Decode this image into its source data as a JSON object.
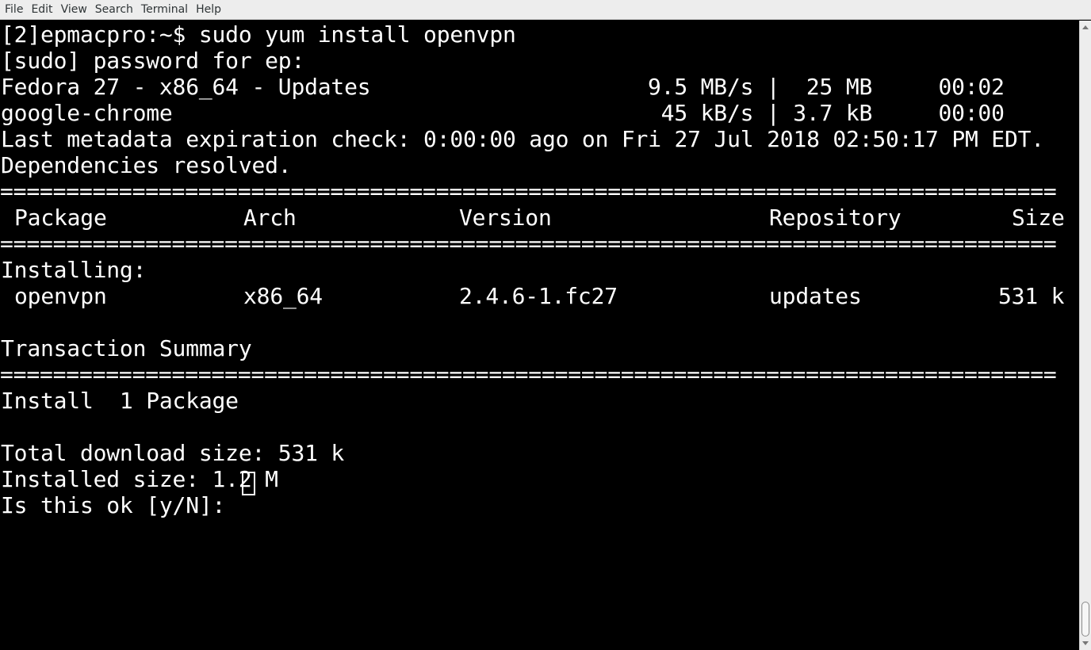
{
  "menu": {
    "file": "File",
    "edit": "Edit",
    "view": "View",
    "search": "Search",
    "terminal": "Terminal",
    "help": "Help"
  },
  "terminal": {
    "lines": {
      "command": "[2]epmacpro:~$ sudo yum install openvpn",
      "sudo_prompt": "[sudo] password for ep:",
      "repo1_name": "Fedora 27 - x86_64 - Updates",
      "repo1_stats": "9.5 MB/s |  25 MB     00:02",
      "repo2_name": "google-chrome",
      "repo2_stats": " 45 kB/s | 3.7 kB     00:00",
      "metadata": "Last metadata expiration check: 0:00:00 ago on Fri 27 Jul 2018 02:50:17 PM EDT.",
      "resolved": "Dependencies resolved.",
      "rule": "================================================================================",
      "installing": "Installing:",
      "transaction_summary": "Transaction Summary",
      "install_count": "Install  1 Package",
      "total_download": "Total download size: 531 k",
      "installed_size": "Installed size: 1.2 M",
      "confirm_prompt": "Is this ok [y/N]: "
    },
    "table": {
      "headers": {
        "package": "Package",
        "arch": "Arch",
        "version": "Version",
        "repository": "Repository",
        "size": "Size"
      },
      "rows": [
        {
          "package": "openvpn",
          "arch": "x86_64",
          "version": "2.4.6-1.fc27",
          "repository": "updates",
          "size": "531 k"
        }
      ]
    }
  }
}
